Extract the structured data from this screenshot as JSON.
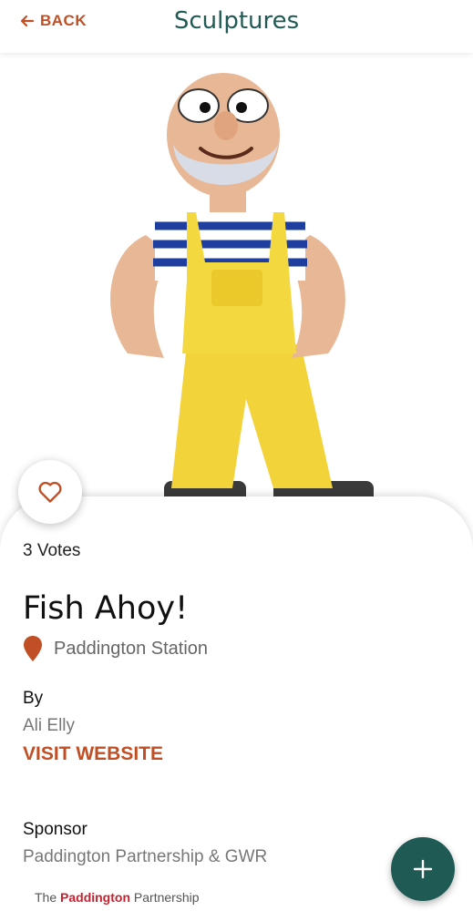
{
  "header": {
    "back_label": "BACK",
    "title": "Sculptures"
  },
  "sculpture": {
    "votes": "3 Votes",
    "name": "Fish Ahoy!",
    "location": "Paddington Station",
    "by_label": "By",
    "artist": "Ali Elly",
    "visit_label": "VISIT WEBSITE",
    "sponsor_label": "Sponsor",
    "sponsor": "Paddington Partnership & GWR",
    "sponsor_logo_prefix": "The ",
    "sponsor_logo_brand": "Paddington",
    "sponsor_logo_suffix": " Partnership"
  },
  "colors": {
    "accent": "#c14f25",
    "brand": "#1f5a54"
  },
  "icons": {
    "back": "arrow-left-icon",
    "favorite": "heart-icon",
    "location": "map-pin-icon",
    "add": "plus-icon"
  }
}
